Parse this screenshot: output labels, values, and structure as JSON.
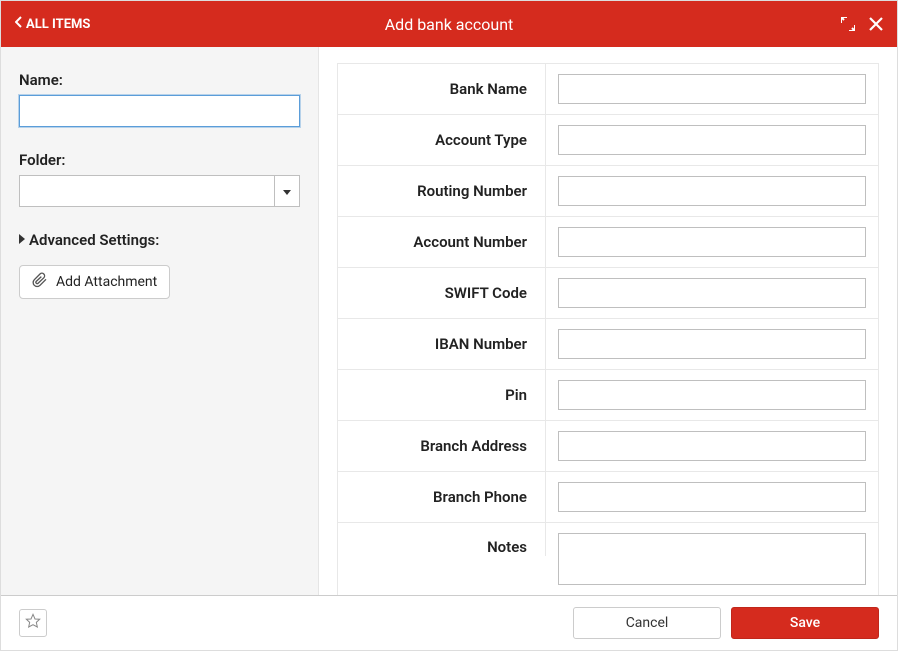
{
  "header": {
    "back_label": "ALL ITEMS",
    "title": "Add bank account"
  },
  "left": {
    "name_label": "Name:",
    "name_value": "",
    "folder_label": "Folder:",
    "folder_value": "",
    "advanced_label": "Advanced Settings:",
    "attach_label": "Add Attachment"
  },
  "fields": [
    {
      "label": "Bank Name",
      "value": ""
    },
    {
      "label": "Account Type",
      "value": ""
    },
    {
      "label": "Routing Number",
      "value": ""
    },
    {
      "label": "Account Number",
      "value": ""
    },
    {
      "label": "SWIFT Code",
      "value": ""
    },
    {
      "label": "IBAN Number",
      "value": ""
    },
    {
      "label": "Pin",
      "value": ""
    },
    {
      "label": "Branch Address",
      "value": ""
    },
    {
      "label": "Branch Phone",
      "value": ""
    },
    {
      "label": "Notes",
      "value": ""
    }
  ],
  "footer": {
    "cancel_label": "Cancel",
    "save_label": "Save"
  },
  "colors": {
    "accent": "#d52b1e"
  }
}
